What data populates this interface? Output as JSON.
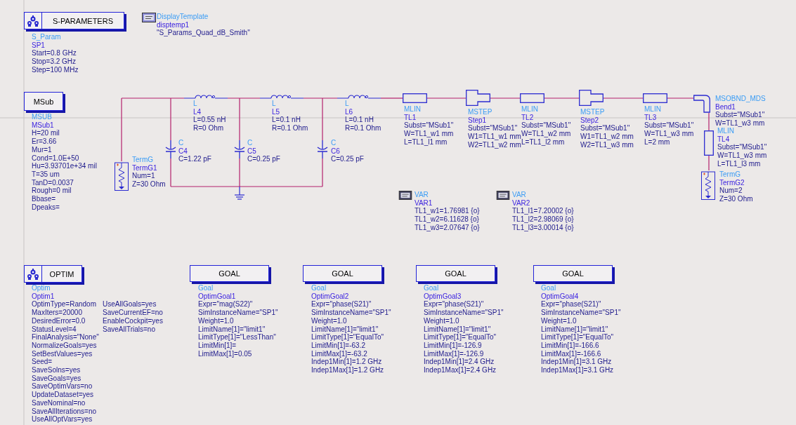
{
  "components": [
    {
      "kind": "sim-box",
      "title": "S-PARAMETERS",
      "type": "S_Param",
      "name": "SP1",
      "params": [
        "Start=0.8 GHz",
        "Stop=3.2 GHz",
        "Step=100 MHz"
      ]
    },
    {
      "kind": "template",
      "type": "DisplayTemplate",
      "name": "disptemp1",
      "params": [
        "\"S_Params_Quad_dB_Smith\""
      ]
    },
    {
      "kind": "title-box",
      "title": "MSub",
      "type": "MSUB",
      "name": "MSub1",
      "params": [
        "H=20 mil",
        "Er=3.66",
        "Mur=1",
        "Cond=1.0E+50",
        "Hu=3.93701e+34 mil",
        "T=35 um",
        "TanD=0.0037",
        "Rough=0 mil",
        "Bbase=",
        "Dpeaks="
      ]
    },
    {
      "kind": "term",
      "type": "TermG",
      "name": "TermG1",
      "params": [
        "Num=1",
        "Z=30 Ohm"
      ]
    },
    {
      "kind": "inductor",
      "type": "L",
      "name": "L4",
      "params": [
        "L=0.55 nH",
        "R=0 Ohm"
      ]
    },
    {
      "kind": "capacitor",
      "type": "C",
      "name": "C4",
      "params": [
        "C=1.22 pF"
      ]
    },
    {
      "kind": "inductor",
      "type": "L",
      "name": "L5",
      "params": [
        "L=0.1 nH",
        "R=0.1 Ohm"
      ]
    },
    {
      "kind": "capacitor",
      "type": "C",
      "name": "C5",
      "params": [
        "C=0.25 pF"
      ]
    },
    {
      "kind": "inductor",
      "type": "L",
      "name": "L6",
      "params": [
        "L=0.1 nH",
        "R=0.1 Ohm"
      ]
    },
    {
      "kind": "capacitor",
      "type": "C",
      "name": "C6",
      "params": [
        "C=0.25 pF"
      ]
    },
    {
      "kind": "line",
      "type": "MLIN",
      "name": "TL1",
      "params": [
        "Subst=\"MSub1\"",
        "W=TL1_w1 mm",
        "L=TL1_l1 mm"
      ]
    },
    {
      "kind": "step",
      "type": "MSTEP",
      "name": "Step1",
      "params": [
        "Subst=\"MSub1\"",
        "W1=TL1_w1 mm",
        "W2=TL1_w2 mm"
      ]
    },
    {
      "kind": "line",
      "type": "MLIN",
      "name": "TL2",
      "params": [
        "Subst=\"MSub1\"",
        "W=TL1_w2 mm",
        "L=TL1_l2 mm"
      ]
    },
    {
      "kind": "step",
      "type": "MSTEP",
      "name": "Step2",
      "params": [
        "Subst=\"MSub1\"",
        "W1=TL1_w2 mm",
        "W2=TL1_w3 mm"
      ]
    },
    {
      "kind": "line",
      "type": "MLIN",
      "name": "TL3",
      "params": [
        "Subst=\"MSub1\"",
        "W=TL1_w3 mm",
        "L=2 mm"
      ]
    },
    {
      "kind": "bend",
      "type": "MSOBND_MDS",
      "name": "Bend1",
      "params": [
        "Subst=\"MSub1\"",
        "W=TL1_w3 mm"
      ]
    },
    {
      "kind": "line-vertical",
      "type": "MLIN",
      "name": "TL4",
      "params": [
        "Subst=\"MSub1\"",
        "W=TL1_w3 mm",
        "L=TL1_l3 mm"
      ]
    },
    {
      "kind": "term",
      "type": "TermG",
      "name": "TermG2",
      "params": [
        "Num=2",
        "Z=30 Ohm"
      ]
    },
    {
      "kind": "var",
      "type": "VAR",
      "name": "VAR1",
      "params": [
        "TL1_w1=1.76981 {o}",
        "TL1_w2=6.11628 {o}",
        "TL1_w3=2.07647 {o}"
      ]
    },
    {
      "kind": "var",
      "type": "VAR",
      "name": "VAR2",
      "params": [
        "TL1_l1=7.20002 {o}",
        "TL1_l2=2.98069 {o}",
        "TL1_l3=3.00014 {o}"
      ]
    },
    {
      "kind": "sim-box",
      "title": "OPTIM",
      "type": "Optim",
      "name": "Optim1",
      "params": [
        "OptimType=Random",
        "MaxIters=20000",
        "DesiredError=0.0",
        "StatusLevel=4",
        "FinalAnalysis=\"None\"",
        "NormalizeGoals=yes",
        "SetBestValues=yes",
        "Seed=",
        "SaveSolns=yes",
        "SaveGoals=yes",
        "SaveOptimVars=no",
        "UpdateDataset=yes",
        "SaveNominal=no",
        "SaveAllIterations=no",
        "UseAllOptVars=yes"
      ],
      "params_2": [
        "UseAllGoals=yes",
        "SaveCurrentEF=no",
        "EnableCockpit=yes",
        "SaveAllTrials=no"
      ]
    },
    {
      "kind": "title-box",
      "title": "GOAL",
      "type": "Goal",
      "name": "OptimGoal1",
      "params": [
        "Expr=\"mag(S22)\"",
        "SimInstanceName=\"SP1\"",
        "Weight=1.0",
        "LimitName[1]=\"limit1\"",
        "LimitType[1]=\"LessThan\"",
        "LimitMin[1]=",
        "LimitMax[1]=0.05"
      ]
    },
    {
      "kind": "title-box",
      "title": "GOAL",
      "type": "Goal",
      "name": "OptimGoal2",
      "params": [
        "Expr=\"phase(S21)\"",
        "SimInstanceName=\"SP1\"",
        "Weight=1.0",
        "LimitName[1]=\"limit1\"",
        "LimitType[1]=\"EqualTo\"",
        "LimitMin[1]=-63.2",
        "LimitMax[1]=-63.2",
        "Indep1Min[1]=1.2 GHz",
        "Indep1Max[1]=1.2 GHz"
      ]
    },
    {
      "kind": "title-box",
      "title": "GOAL",
      "type": "Goal",
      "name": "OptimGoal3",
      "params": [
        "Expr=\"phase(S21)\"",
        "SimInstanceName=\"SP1\"",
        "Weight=1.0",
        "LimitName[1]=\"limit1\"",
        "LimitType[1]=\"EqualTo\"",
        "LimitMin[1]=-126.9",
        "LimitMax[1]=-126.9",
        "Indep1Min[1]=2.4 GHz",
        "Indep1Max[1]=2.4 GHz"
      ]
    },
    {
      "kind": "title-box",
      "title": "GOAL",
      "type": "Goal",
      "name": "OptimGoal4",
      "params": [
        "Expr=\"phase(S21)\"",
        "SimInstanceName=\"SP1\"",
        "Weight=1.0",
        "LimitName[1]=\"limit1\"",
        "LimitType[1]=\"EqualTo\"",
        "LimitMin[1]=-166.6",
        "LimitMax[1]=-166.6",
        "Indep1Min[1]=3.1 GHz",
        "Indep1Max[1]=3.1 GHz"
      ]
    }
  ]
}
